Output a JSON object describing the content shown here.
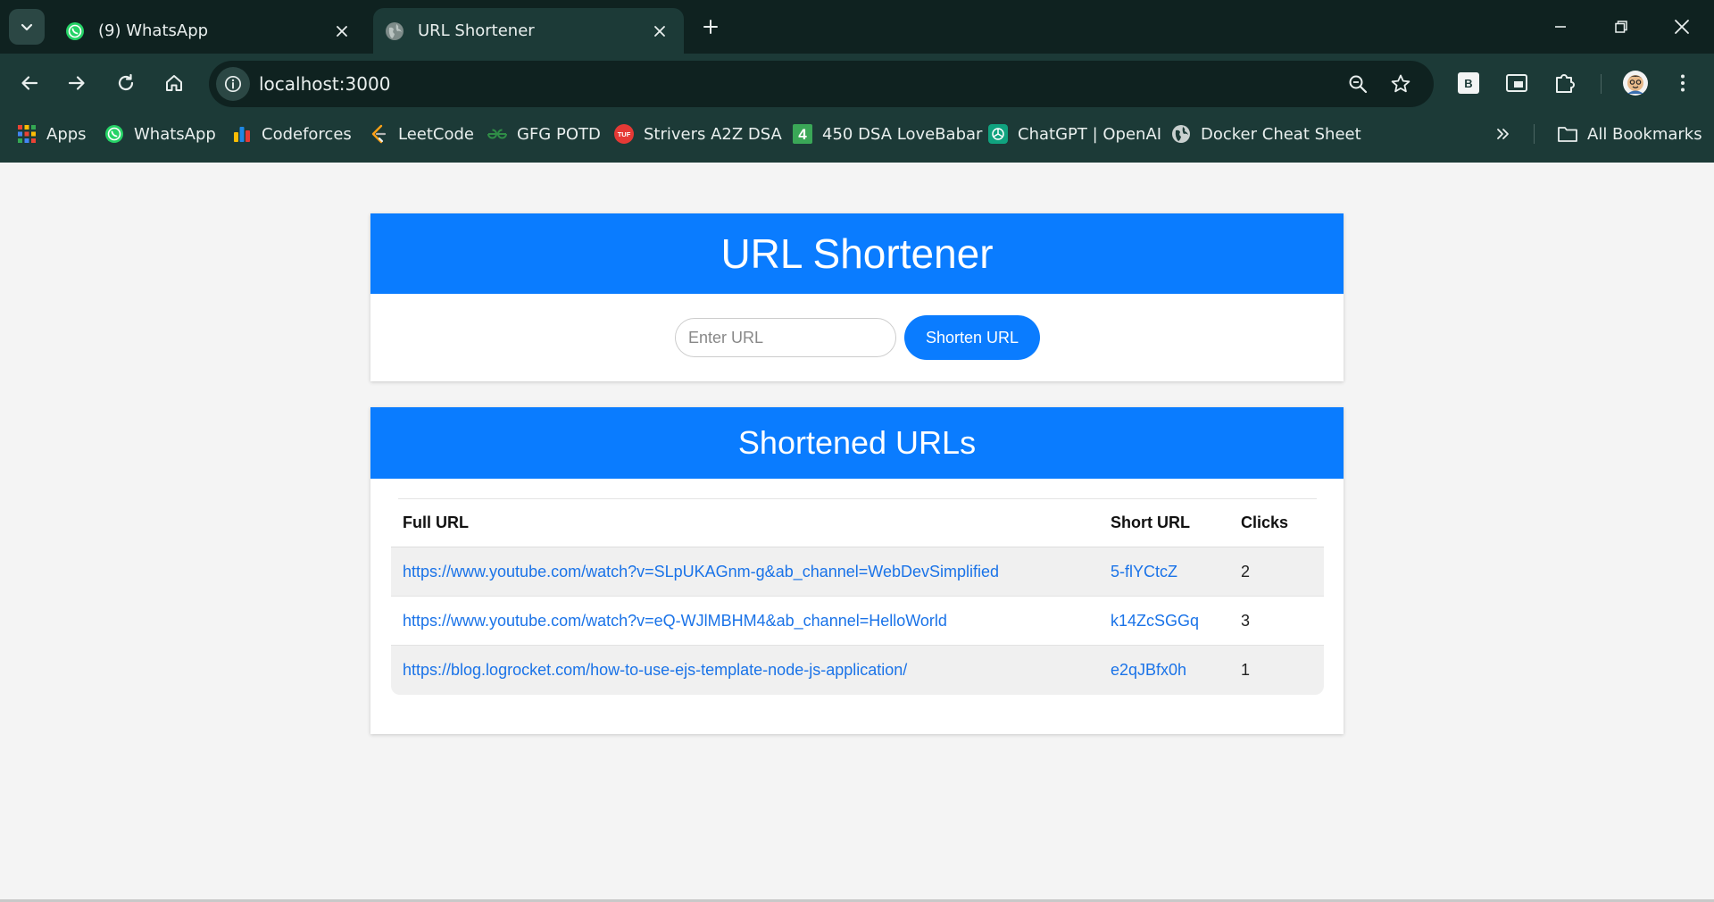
{
  "browser": {
    "tabs": [
      {
        "title": "(9) WhatsApp",
        "icon": "whatsapp-icon",
        "active": false
      },
      {
        "title": "URL Shortener",
        "icon": "globe-icon",
        "active": true
      }
    ],
    "address": "localhost:3000",
    "colors": {
      "frame": "#0f2220",
      "toolbar": "#1c3a37",
      "text": "#e9efee"
    }
  },
  "bookmarks": {
    "items": [
      {
        "label": "Apps",
        "icon": "apps-grid-icon"
      },
      {
        "label": "WhatsApp",
        "icon": "whatsapp-icon"
      },
      {
        "label": "Codeforces",
        "icon": "codeforces-icon"
      },
      {
        "label": "LeetCode",
        "icon": "leetcode-icon"
      },
      {
        "label": "GFG POTD",
        "icon": "gfg-icon"
      },
      {
        "label": "Strivers A2Z DSA",
        "icon": "tuf-icon"
      },
      {
        "label": "450 DSA LoveBabar",
        "icon": "number-4-icon"
      },
      {
        "label": "ChatGPT | OpenAI",
        "icon": "openai-icon"
      },
      {
        "label": "Docker Cheat Sheet",
        "icon": "globe-icon"
      }
    ],
    "all_bookmarks": "All Bookmarks"
  },
  "app": {
    "title": "URL Shortener",
    "input_placeholder": "Enter URL",
    "input_value": "",
    "button_label": "Shorten URL",
    "list_title": "Shortened URLs",
    "columns": [
      "Full URL",
      "Short URL",
      "Clicks"
    ],
    "rows": [
      {
        "full": "https://www.youtube.com/watch?v=SLpUKAGnm-g&ab_channel=WebDevSimplified",
        "short": "5-flYCtcZ",
        "clicks": "2"
      },
      {
        "full": "https://www.youtube.com/watch?v=eQ-WJlMBHM4&ab_channel=HelloWorld",
        "short": "k14ZcSGGq",
        "clicks": "3"
      },
      {
        "full": "https://blog.logrocket.com/how-to-use-ejs-template-node-js-application/",
        "short": "e2qJBfx0h",
        "clicks": "1"
      }
    ],
    "colors": {
      "accent": "#0a7cff",
      "link": "#1a73e8",
      "page_bg": "#f4f4f4"
    }
  }
}
